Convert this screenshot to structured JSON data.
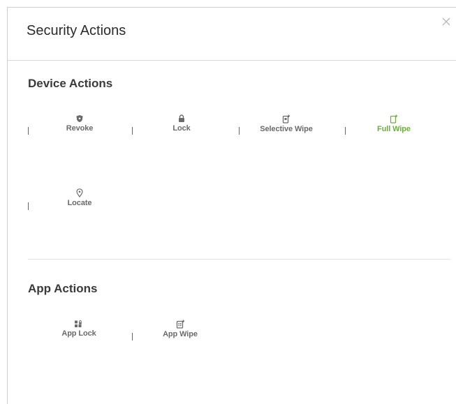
{
  "dialog": {
    "title": "Security Actions"
  },
  "device_actions": {
    "heading": "Device Actions",
    "items": [
      {
        "label": "Revoke",
        "icon": "shield-icon",
        "active": false
      },
      {
        "label": "Lock",
        "icon": "lock-icon",
        "active": false
      },
      {
        "label": "Selective Wipe",
        "icon": "selective-wipe-icon",
        "active": false
      },
      {
        "label": "Full Wipe",
        "icon": "full-wipe-icon",
        "active": true
      },
      {
        "label": "Locate",
        "icon": "location-pin-icon",
        "active": false
      }
    ]
  },
  "app_actions": {
    "heading": "App Actions",
    "items": [
      {
        "label": "App Lock",
        "icon": "app-lock-icon",
        "active": false
      },
      {
        "label": "App Wipe",
        "icon": "app-wipe-icon",
        "active": false
      }
    ]
  },
  "colors": {
    "accent": "#6cae3f",
    "text": "#6a6a6a",
    "divider": "#e2e2e2"
  }
}
